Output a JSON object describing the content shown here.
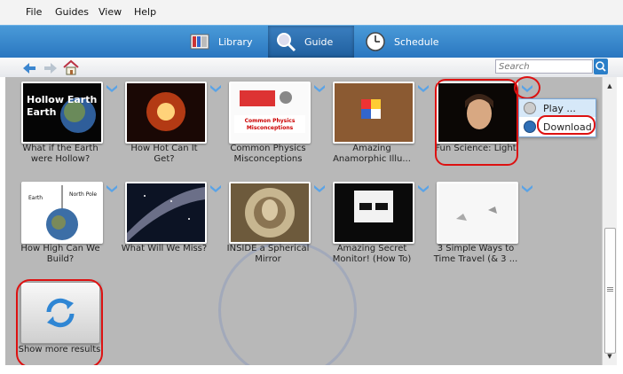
{
  "menu": [
    "File",
    "Guides",
    "View",
    "Help"
  ],
  "tabs": [
    {
      "label": "Library",
      "icon": "library-icon",
      "active": false
    },
    {
      "label": "Guide",
      "icon": "magnifier-icon",
      "active": true
    },
    {
      "label": "Schedule",
      "icon": "clock-icon",
      "active": false
    }
  ],
  "search": {
    "placeholder": "Search"
  },
  "items": [
    {
      "caption": "What if the Earth were Hollow?",
      "thumb_text": "Hollow Earth"
    },
    {
      "caption": "How Hot Can It Get?"
    },
    {
      "caption": "Common Physics Misconceptions",
      "thumb_text": "Common Physics Misconceptions"
    },
    {
      "caption": "Amazing Anamorphic Illu..."
    },
    {
      "caption": "Fun Science: Light"
    },
    {
      "caption": "How High Can We Build?",
      "thumb_text_1": "Earth",
      "thumb_text_2": "North Pole"
    },
    {
      "caption": "What Will We Miss?"
    },
    {
      "caption": "INSIDE a Spherical Mirror"
    },
    {
      "caption": "Amazing Secret Monitor! (How To)"
    },
    {
      "caption": "3 Simple Ways to Time Travel (& 3 ..."
    }
  ],
  "show_more": "Show more results",
  "context_menu": [
    {
      "label": "Play ...",
      "icon": "play-icon"
    },
    {
      "label": "Download",
      "icon": "download-icon"
    }
  ],
  "colors": {
    "accent": "#2a77c0",
    "highlight_ring": "#dd1111",
    "grid_bg": "#b8b8b8"
  }
}
